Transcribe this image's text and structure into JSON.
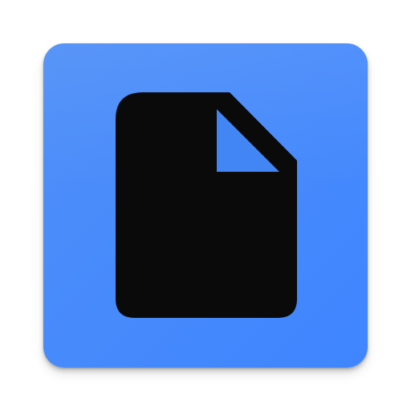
{
  "app_icon": {
    "icon": "document-icon",
    "background_color": "#4285f4",
    "glyph_color": "#0a0a0a",
    "fold_color": "#4285f4"
  }
}
